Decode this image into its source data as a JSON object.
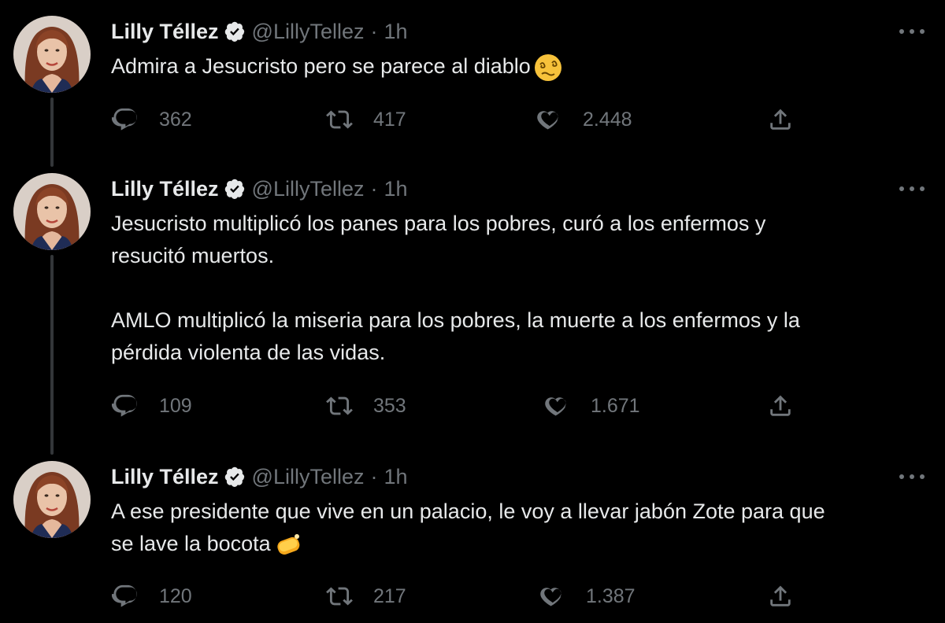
{
  "tweets": [
    {
      "name": "Lilly Téllez",
      "handle": "@LillyTellez",
      "separator": "·",
      "time": "1h",
      "paragraphs": [
        [
          "Admira a Jesucristo pero se parece al diablo"
        ]
      ],
      "emoji": "woozy-face",
      "stats": {
        "replies": "362",
        "retweets": "417",
        "likes": "2.448"
      }
    },
    {
      "name": "Lilly Téllez",
      "handle": "@LillyTellez",
      "separator": "·",
      "time": "1h",
      "paragraphs": [
        [
          "Jesucristo multiplicó los panes para los pobres, curó a los enfermos y",
          "resucitó muertos."
        ],
        [
          "AMLO multiplicó la miseria para los pobres, la muerte a los enfermos y la",
          "pérdida violenta de las vidas."
        ]
      ],
      "stats": {
        "replies": "109",
        "retweets": "353",
        "likes": "1.671"
      }
    },
    {
      "name": "Lilly Téllez",
      "handle": "@LillyTellez",
      "separator": "·",
      "time": "1h",
      "paragraphs": [
        [
          "A ese presidente que vive en un palacio, le voy a llevar jabón Zote para que",
          "se lave la bocota"
        ]
      ],
      "emoji": "soap",
      "stats": {
        "replies": "120",
        "retweets": "217",
        "likes": "1.387"
      }
    }
  ],
  "icons": {
    "reply": "reply-icon",
    "retweet": "retweet-icon",
    "like": "like-icon",
    "share": "share-icon",
    "verified": "verified-badge-icon",
    "more": "more-options-icon"
  },
  "colors": {
    "background": "#000000",
    "text": "#e7e9ea",
    "secondary": "#71767b",
    "thread_line": "#333639"
  }
}
